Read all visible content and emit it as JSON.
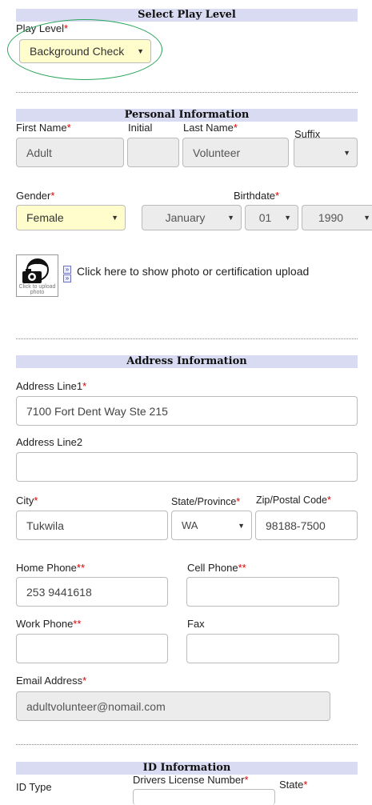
{
  "play_level": {
    "header": "Select Play Level",
    "label": "Play Level",
    "value": "Background Check"
  },
  "personal": {
    "header": "Personal Information",
    "first_name_label": "First Name",
    "initial_label": "Initial",
    "last_name_label": "Last Name",
    "suffix_label": "Suffix",
    "first_name_value": "Adult",
    "initial_value": "",
    "last_name_value": "Volunteer",
    "suffix_value": "",
    "gender_label": "Gender",
    "gender_value": "Female",
    "birthdate_label": "Birthdate",
    "birth_month": "January",
    "birth_day": "01",
    "birth_year": "1990",
    "photo_icon_caption": "Click to upload photo",
    "photo_link_text": "Click here to show photo or certification upload"
  },
  "address": {
    "header": "Address Information",
    "line1_label": "Address Line1",
    "line1_value": "7100 Fort Dent Way Ste 215",
    "line2_label": "Address Line2",
    "line2_value": "",
    "city_label": "City",
    "city_value": "Tukwila",
    "state_label": "State/Province",
    "state_value": "WA",
    "zip_label": "Zip/Postal Code",
    "zip_value": "98188-7500",
    "home_phone_label": "Home Phone",
    "home_phone_value": "253 9441618",
    "cell_phone_label": "Cell Phone",
    "cell_phone_value": "",
    "work_phone_label": "Work Phone",
    "work_phone_value": "",
    "fax_label": "Fax",
    "fax_value": "",
    "email_label": "Email Address",
    "email_value": "adultvolunteer@nomail.com"
  },
  "id_info": {
    "header": "ID Information",
    "id_type_label": "ID Type",
    "license_label": "Drivers License Number",
    "state_label": "State"
  },
  "markers": {
    "required": "*",
    "one_of_required": "**"
  },
  "colors": {
    "header_bg": "#d9dbf2",
    "required_mark": "#dd0000",
    "highlight_field": "#fffdcc",
    "readonly_field": "#ececec",
    "annotation_oval": "#2ba65a"
  }
}
